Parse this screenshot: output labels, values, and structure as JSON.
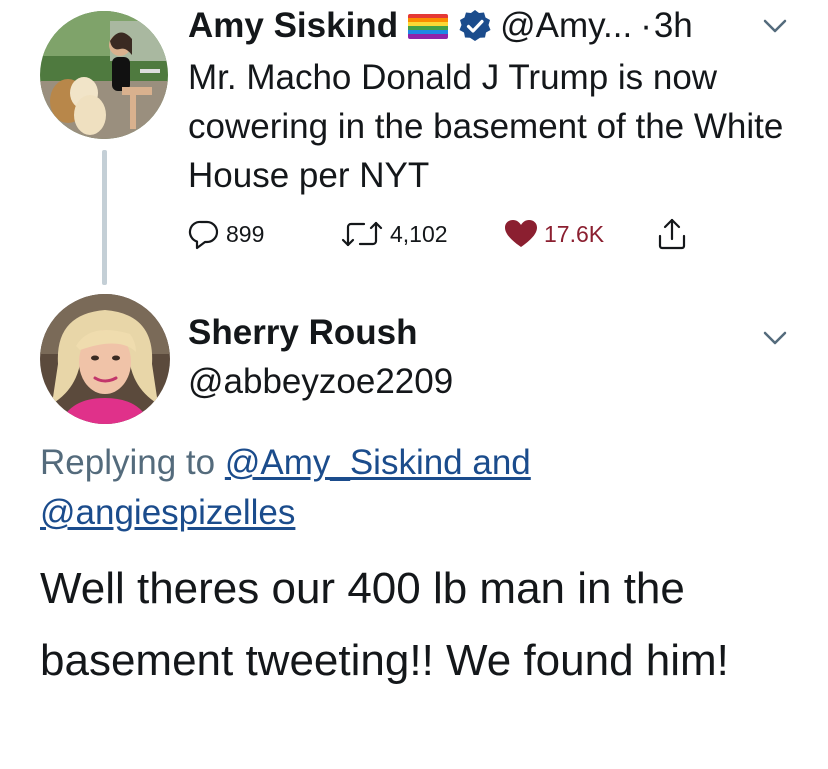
{
  "tweet": {
    "avatar": "avatar-woman-with-dogs",
    "display_name": "Amy Siskind",
    "flag": "rainbow-flag",
    "verified": "verified-badge-icon",
    "handle": "@Amy...",
    "dot": "·",
    "time": "3h",
    "text": "Mr. Macho Donald J Trump is now cowering in the basement of the White House per NYT",
    "actions": {
      "reply_count": "899",
      "retweet_count": "4,102",
      "like_count": "17.6K"
    },
    "colors": {
      "like": "#8b1f30",
      "thread_line": "#c4cfd6"
    }
  },
  "reply": {
    "avatar": "avatar-blonde-woman",
    "display_name": "Sherry Roush",
    "handle": "@abbeyzoe2209",
    "replying_prefix": "Replying to ",
    "mention_1": "@Amy_Siskind and",
    "mention_2": "@angiespizelles",
    "text": "Well theres our 400 lb man in the basement tweeting!! We found him!",
    "colors": {
      "mention": "#1b4c8c",
      "replying_to": "#546b7c"
    }
  }
}
